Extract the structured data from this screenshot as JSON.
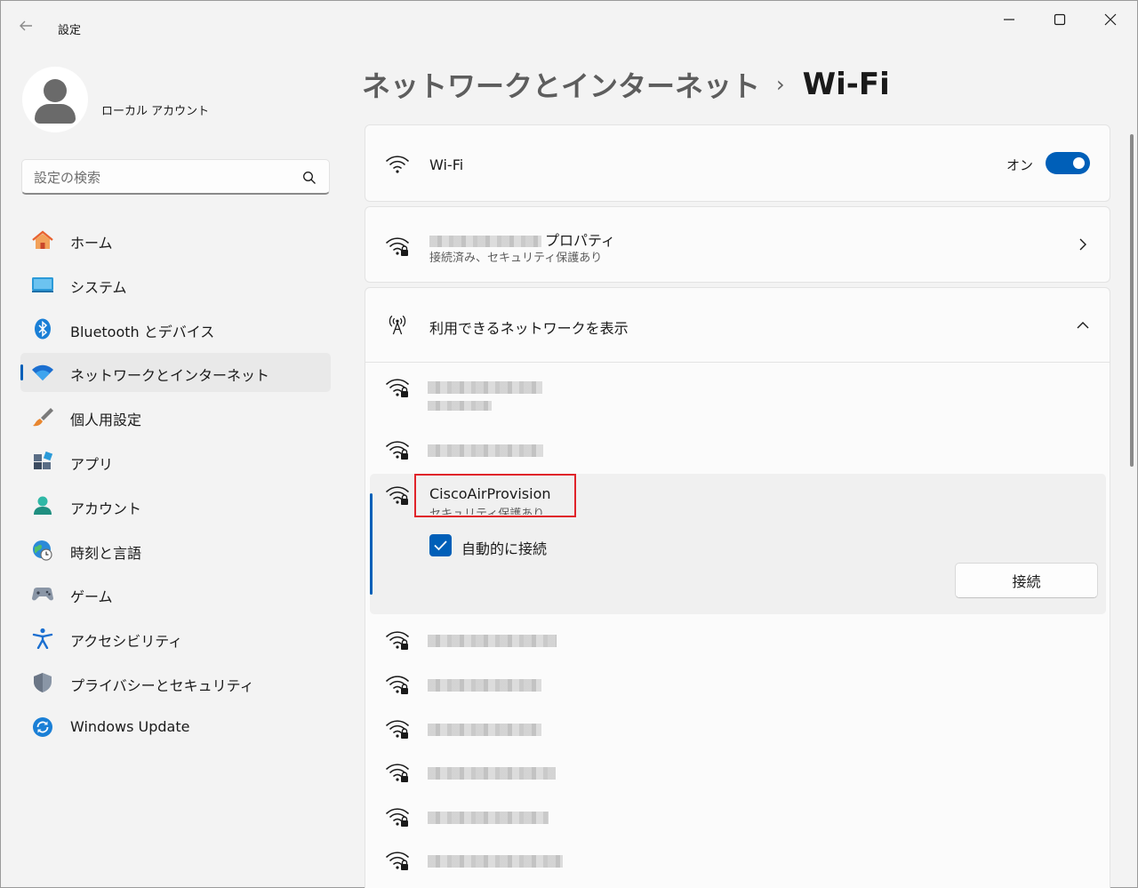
{
  "window": {
    "title": "設定"
  },
  "account": {
    "name": "ローカル アカウント"
  },
  "search": {
    "placeholder": "設定の検索"
  },
  "sidebar": {
    "items": [
      {
        "label": "ホーム",
        "icon": "home-icon"
      },
      {
        "label": "システム",
        "icon": "system-icon"
      },
      {
        "label": "Bluetooth とデバイス",
        "icon": "bluetooth-icon"
      },
      {
        "label": "ネットワークとインターネット",
        "icon": "network-icon",
        "selected": true
      },
      {
        "label": "個人用設定",
        "icon": "brush-icon"
      },
      {
        "label": "アプリ",
        "icon": "apps-icon"
      },
      {
        "label": "アカウント",
        "icon": "account-icon"
      },
      {
        "label": "時刻と言語",
        "icon": "time-language-icon"
      },
      {
        "label": "ゲーム",
        "icon": "gamepad-icon"
      },
      {
        "label": "アクセシビリティ",
        "icon": "accessibility-icon"
      },
      {
        "label": "プライバシーとセキュリティ",
        "icon": "shield-icon"
      },
      {
        "label": "Windows Update",
        "icon": "update-icon"
      }
    ]
  },
  "breadcrumb": {
    "parent": "ネットワークとインターネット",
    "separator": "›",
    "current": "Wi-Fi"
  },
  "wifi_card": {
    "label": "Wi-Fi",
    "toggle_label": "オン",
    "toggle_on": true
  },
  "properties_card": {
    "title_suffix": "プロパティ",
    "subtitle": "接続済み、セキュリティ保護あり"
  },
  "networks_card": {
    "label": "利用できるネットワークを表示",
    "expanded": true
  },
  "selected_network": {
    "name": "CiscoAirProvision",
    "status": "セキュリティ保護あり",
    "auto_connect_label": "自動的に接続",
    "auto_connect_checked": true,
    "connect_label": "接続"
  },
  "colors": {
    "accent": "#005fb8",
    "highlight": "#e0232a"
  }
}
